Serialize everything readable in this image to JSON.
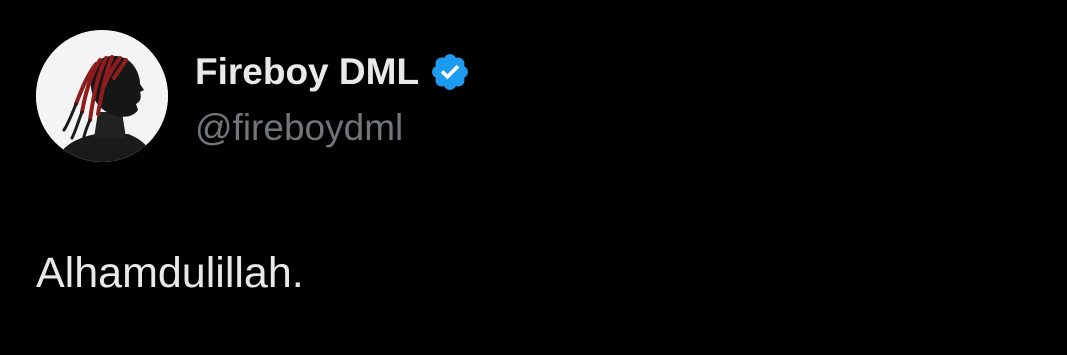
{
  "author": {
    "display_name": "Fireboy DML",
    "handle": "@fireboydml",
    "verified": true,
    "avatar_icon": "profile-photo-silhouette"
  },
  "tweet": {
    "text": "Alhamdulillah."
  },
  "colors": {
    "background": "#000000",
    "name": "#e7e9ea",
    "handle": "#71767b",
    "verified_badge": "#1d9bf0"
  }
}
